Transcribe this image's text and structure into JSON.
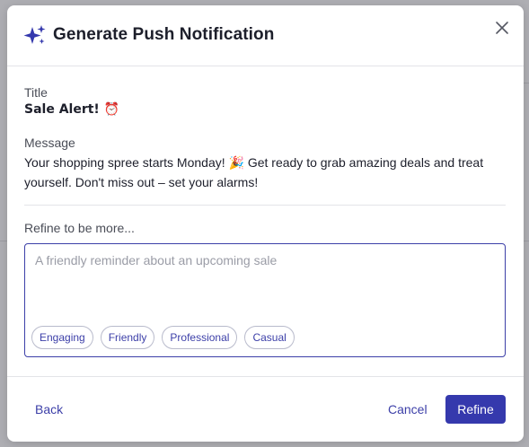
{
  "dialog": {
    "title": "Generate Push Notification",
    "close_icon": "close-icon",
    "sparkle_icon": "sparkles-icon"
  },
  "notification": {
    "title_label": "Title",
    "title_value": "Sale Alert! ⏰",
    "message_label": "Message",
    "message_value": "Your shopping spree starts Monday! 🎉 Get ready to grab amazing deals and treat yourself. Don't miss out – set your alarms!"
  },
  "refine": {
    "label": "Refine to be more...",
    "placeholder": "A friendly reminder about an upcoming sale",
    "chips": [
      "Engaging",
      "Friendly",
      "Professional",
      "Casual"
    ]
  },
  "footer": {
    "back_label": "Back",
    "cancel_label": "Cancel",
    "refine_label": "Refine"
  },
  "colors": {
    "accent": "#3539ad",
    "text": "#1d1f2b",
    "muted": "#4a4d57"
  }
}
